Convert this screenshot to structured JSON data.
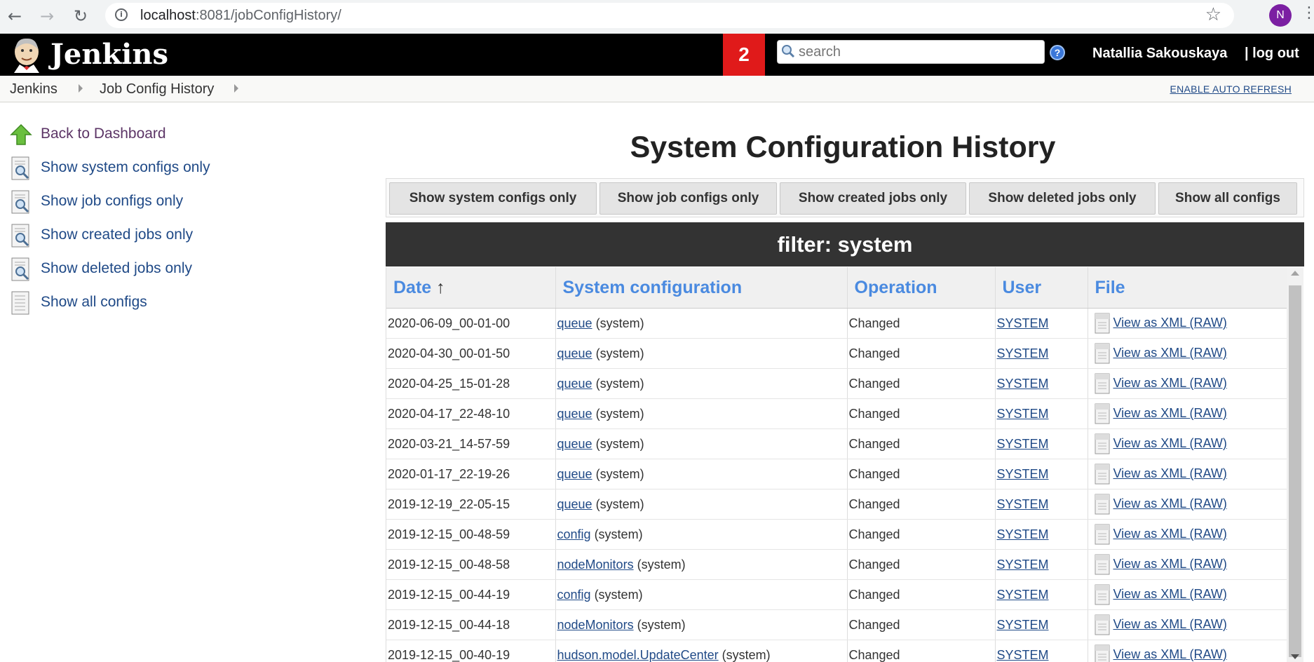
{
  "browser": {
    "url_host": "localhost",
    "url_rest": ":8081/jobConfigHistory/",
    "profile_initial": "N"
  },
  "header": {
    "logo_text": "Jenkins",
    "notification_count": "2",
    "search_placeholder": "search",
    "username": "Natallia Sakouskaya",
    "logout": "| log out"
  },
  "breadcrumb": {
    "items": [
      "Jenkins",
      "Job Config History"
    ],
    "auto_refresh": "ENABLE AUTO REFRESH"
  },
  "sidebar": {
    "items": [
      {
        "label": "Back to Dashboard",
        "icon": "up-arrow-icon"
      },
      {
        "label": "Show system configs only",
        "icon": "search-document-icon"
      },
      {
        "label": "Show job configs only",
        "icon": "search-document-icon"
      },
      {
        "label": "Show created jobs only",
        "icon": "search-document-icon"
      },
      {
        "label": "Show deleted jobs only",
        "icon": "search-document-icon"
      },
      {
        "label": "Show all configs",
        "icon": "document-icon"
      }
    ]
  },
  "main": {
    "title": "System Configuration History",
    "filter_buttons": [
      "Show system configs only",
      "Show job configs only",
      "Show created jobs only",
      "Show deleted jobs only",
      "Show all configs"
    ],
    "filter_label": "filter: system",
    "columns": [
      "Date",
      "System configuration",
      "Operation",
      "User",
      "File"
    ],
    "sort_indicator": "↑",
    "suffix": "(system)",
    "view_xml": "View as XML ",
    "raw": "(RAW)",
    "rows": [
      {
        "date": "2020-06-09_00-01-00",
        "config": "queue",
        "operation": "Changed",
        "user": "SYSTEM"
      },
      {
        "date": "2020-04-30_00-01-50",
        "config": "queue",
        "operation": "Changed",
        "user": "SYSTEM"
      },
      {
        "date": "2020-04-25_15-01-28",
        "config": "queue",
        "operation": "Changed",
        "user": "SYSTEM"
      },
      {
        "date": "2020-04-17_22-48-10",
        "config": "queue",
        "operation": "Changed",
        "user": "SYSTEM"
      },
      {
        "date": "2020-03-21_14-57-59",
        "config": "queue",
        "operation": "Changed",
        "user": "SYSTEM"
      },
      {
        "date": "2020-01-17_22-19-26",
        "config": "queue",
        "operation": "Changed",
        "user": "SYSTEM"
      },
      {
        "date": "2019-12-19_22-05-15",
        "config": "queue",
        "operation": "Changed",
        "user": "SYSTEM"
      },
      {
        "date": "2019-12-15_00-48-59",
        "config": "config",
        "operation": "Changed",
        "user": "SYSTEM"
      },
      {
        "date": "2019-12-15_00-48-58",
        "config": "nodeMonitors",
        "operation": "Changed",
        "user": "SYSTEM"
      },
      {
        "date": "2019-12-15_00-44-19",
        "config": "config",
        "operation": "Changed",
        "user": "SYSTEM"
      },
      {
        "date": "2019-12-15_00-44-18",
        "config": "nodeMonitors",
        "operation": "Changed",
        "user": "SYSTEM"
      },
      {
        "date": "2019-12-15_00-40-19",
        "config": "hudson.model.UpdateCenter",
        "operation": "Changed",
        "user": "SYSTEM"
      }
    ]
  },
  "colors": {
    "header_bg": "#000000",
    "notification_bg": "#e01a1a",
    "link": "#204a87",
    "column_header": "#4a8ae0",
    "filter_bar_bg": "#333333"
  }
}
